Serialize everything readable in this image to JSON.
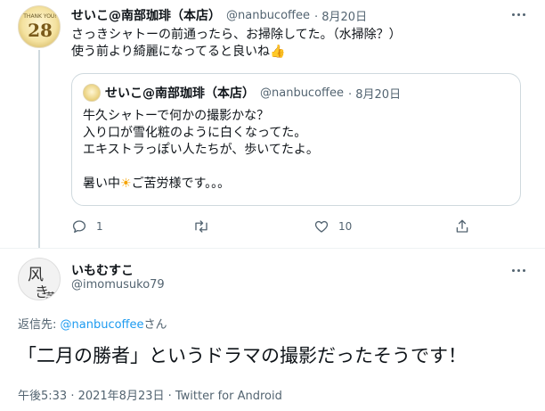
{
  "quoted_tweet_author": {
    "name": "せいこ@南部珈琲（本店）",
    "handle": "@nanbucoffee",
    "date": "· 8月20日",
    "avatar_text_top": "THANK YOU!",
    "avatar_text_num": "28"
  },
  "tweet1": {
    "line1": "さっきシャトーの前通ったら、お掃除してた。（水掃除？）",
    "line2": "使う前より綺麗になってると良いね",
    "thumb_emoji": "👍",
    "quote": {
      "name": "せいこ@南部珈琲（本店）",
      "handle": "@nanbucoffee",
      "date": "· 8月20日",
      "lines": [
        "牛久シャトーで何かの撮影かな？",
        "入り口が雪化粧のように白くなってた。",
        "エキストラっぽい人たちが、歩いてたよ。",
        ""
      ],
      "last_line_before": "暑い中",
      "sun_emoji": "☀",
      "last_line_after": "ご苦労様です。。。"
    },
    "actions": {
      "reply_count": "1",
      "retweet_count": "",
      "like_count": "10"
    }
  },
  "tweet2": {
    "name": "いもむすこ",
    "handle": "@imomusuko79",
    "reply_label": "返信先: ",
    "reply_link": "@nanbucoffee",
    "reply_suffix": "さん",
    "text": "「二月の勝者」というドラマの撮影だったそうです！",
    "meta": "午後5:33 · 2021年8月23日 · Twitter for Android",
    "avatar_chars": [
      "风",
      "き",
      "芋"
    ]
  },
  "colors": {
    "link": "#1d9bf0",
    "secondary_text": "#536471",
    "border": "#cfd9de"
  }
}
